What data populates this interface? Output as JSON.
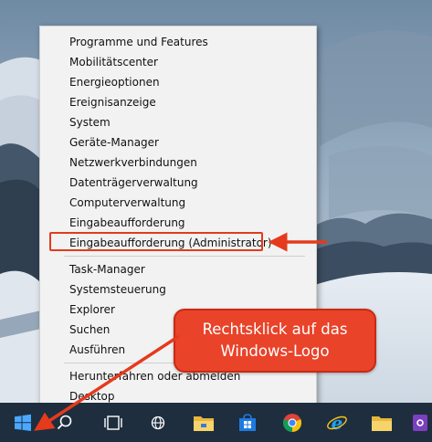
{
  "context_menu": {
    "groups": [
      [
        "Programme und Features",
        "Mobilitätscenter",
        "Energieoptionen",
        "Ereignisanzeige",
        "System",
        "Geräte-Manager",
        "Netzwerkverbindungen",
        "Datenträgerverwaltung",
        "Computerverwaltung",
        "Eingabeaufforderung",
        "Eingabeaufforderung (Administrator)"
      ],
      [
        "Task-Manager",
        "Systemsteuerung",
        "Explorer",
        "Suchen",
        "Ausführen"
      ],
      [
        "Herunterfahren oder abmelden",
        "Desktop"
      ]
    ],
    "highlighted_item": "Eingabeaufforderung (Administrator)"
  },
  "callout": {
    "line1": "Rechtsklick auf das",
    "line2": "Windows-Logo"
  },
  "taskbar": {
    "icons": [
      "windows-logo-icon",
      "search-icon",
      "task-view-icon",
      "network-icon",
      "file-explorer-icon",
      "store-icon",
      "chrome-icon",
      "internet-explorer-icon",
      "folder-icon",
      "app-icon"
    ]
  },
  "colors": {
    "annotation_red": "#e9432a",
    "taskbar": "#1e2e3f",
    "menu_bg": "#f2f2f2"
  }
}
